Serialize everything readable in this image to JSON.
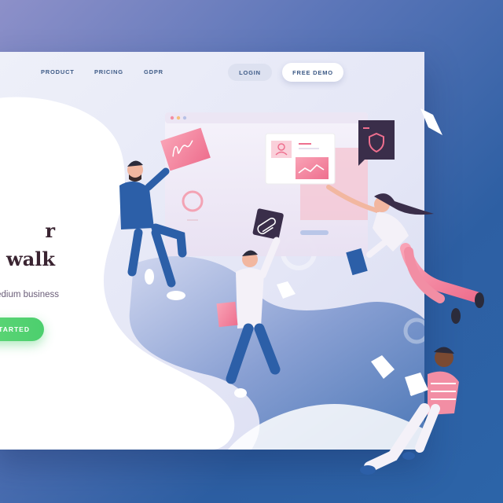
{
  "nav": {
    "links": [
      "PRODUCT",
      "PRICING",
      "GDPR"
    ],
    "login_label": "LOGIN",
    "demo_label": "FREE DEMO"
  },
  "hero": {
    "title_line1": "r",
    "title_line2": "n walk",
    "subtitle": "edium business",
    "cta_label": "TARTED"
  },
  "colors": {
    "nav_text": "#3d5a86",
    "cta_green": "#4ccf6e",
    "title_text": "#3a2431",
    "background_blue": "#2d5fa3",
    "accent_pink": "#f27a93"
  },
  "icons": [
    "signature-card-icon",
    "paperclip-icon",
    "shield-icon",
    "profile-card-icon",
    "chart-card-icon"
  ]
}
